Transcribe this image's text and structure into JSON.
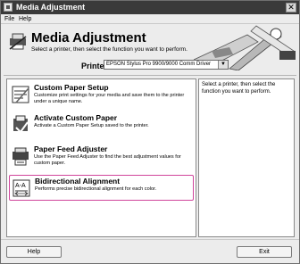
{
  "window": {
    "title": "Media Adjustment",
    "close_glyph": "✕"
  },
  "menubar": {
    "file": "File",
    "help": "Help"
  },
  "header": {
    "heading": "Media Adjustment",
    "subheading": "Select a printer, then select the function you want to perform."
  },
  "printer": {
    "label": "Printer",
    "selected": "EPSON Stylus Pro 9900/9000 Comm Driver"
  },
  "functions": [
    {
      "label": "Custom Paper Setup",
      "description": "Customize print settings for your media and save them to the printer under a unique name.",
      "icon": "custom-paper-icon",
      "selected": false
    },
    {
      "label": "Activate Custom Paper",
      "description": "Activate a Custom Paper Setup saved to the printer.",
      "icon": "activate-paper-icon",
      "selected": false
    },
    {
      "label": "Paper Feed Adjuster",
      "description": "Use the Paper Feed Adjuster to find the best adjustment values for custom paper.",
      "icon": "paper-feed-icon",
      "selected": false
    },
    {
      "label": "Bidirectional Alignment",
      "description": "Performs precise bidirectional alignment for each color.",
      "icon": "bidirectional-alignment-icon",
      "selected": true
    }
  ],
  "info_panel": {
    "text": "Select a printer, then select the function you want to perform."
  },
  "footer": {
    "help_label": "Help",
    "exit_label": "Exit"
  },
  "colors": {
    "titlebar": "#3a3a3a",
    "selection_border": "#d0449b",
    "window_bg": "#ececec"
  }
}
